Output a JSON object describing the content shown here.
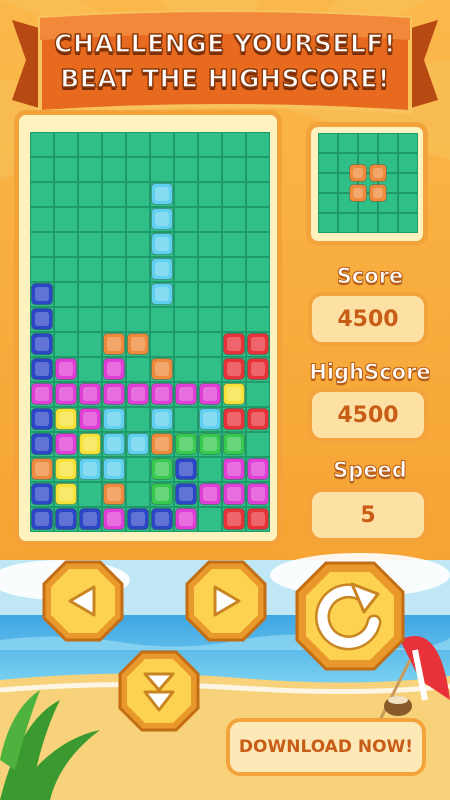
{
  "banner": {
    "line1": "CHALLENGE YOURSELF!",
    "line2": "BEAT THE HIGHSCORE!"
  },
  "stats": {
    "score_label": "Score",
    "score_value": "4500",
    "highscore_label": "HighScore",
    "highscore_value": "4500",
    "speed_label": "Speed",
    "speed_value": "5"
  },
  "download_label": "DOWNLOAD NOW!",
  "colors": {
    "board_bg": "#2fbf87",
    "grid_line": "#1f9b6b",
    "frame": "#f3a33c",
    "panel_fill": "#fff2bf",
    "sky_top": "#f9b13a",
    "ocean": "#4db3e6",
    "sand": "#f7d27a",
    "block_colors": {
      "b": "#2c46c8",
      "m": "#df3fd6",
      "c": "#5fd1ee",
      "o": "#ee8a3c",
      "r": "#e8323a",
      "y": "#f6e23a",
      "g": "#37c950"
    }
  },
  "board": {
    "cols": 10,
    "rows": 16,
    "falling_piece": {
      "color": "c",
      "cells": [
        [
          5,
          2
        ],
        [
          5,
          3
        ],
        [
          5,
          4
        ],
        [
          5,
          5
        ],
        [
          5,
          6
        ]
      ]
    },
    "locked": [
      "..........",
      "..........",
      "..........",
      "..........",
      "..........",
      "..........",
      "b.........",
      "b.........",
      "b..oo...rr",
      "bm.m.o..rr",
      "mmmmmmmmy.",
      "bymc.c.crr",
      "bmyccoggg.",
      "oycc.gb.mm",
      "by.o.gbmmm",
      "bbbmbbm.rr"
    ]
  },
  "next_piece": {
    "color": "o",
    "cells": [
      [
        0,
        0
      ],
      [
        1,
        0
      ],
      [
        0,
        1
      ],
      [
        1,
        1
      ]
    ]
  }
}
